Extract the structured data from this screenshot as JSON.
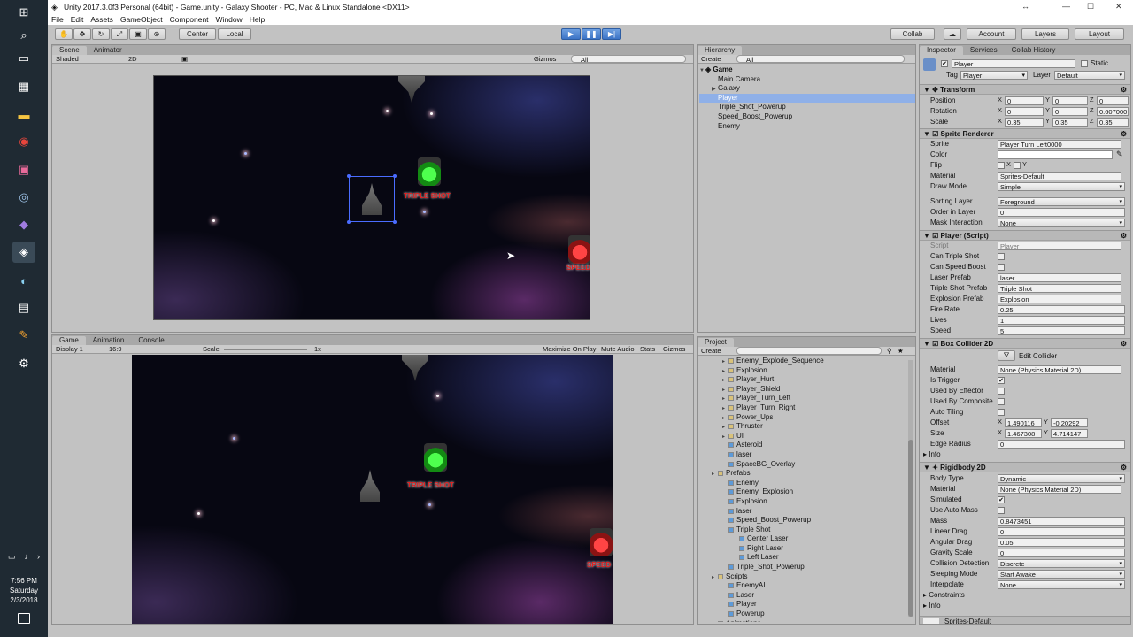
{
  "window": {
    "title": "Unity 2017.3.0f3 Personal (64bit) - Game.unity - Galaxy Shooter - PC, Mac & Linux Standalone <DX11>"
  },
  "menu": [
    "File",
    "Edit",
    "Assets",
    "GameObject",
    "Component",
    "Window",
    "Help"
  ],
  "toolbar": {
    "center": "Center",
    "local": "Local",
    "collab": "Collab",
    "account": "Account",
    "layers": "Layers",
    "layout": "Layout"
  },
  "taskbar": {
    "time": "7:56 PM",
    "day": "Saturday",
    "date": "2/3/2018"
  },
  "scene": {
    "tabs": [
      "Scene",
      "Animator"
    ],
    "shading": "Shaded",
    "mode2d": "2D",
    "gizmos": "Gizmos",
    "search": "All",
    "triple_shot_label": "TRIPLE SHOT",
    "speed_label": "SPEED"
  },
  "game": {
    "tabs": [
      "Game",
      "Animation",
      "Console"
    ],
    "display": "Display 1",
    "aspect": "16:9",
    "scale_label": "Scale",
    "scale_value": "1x",
    "maximize": "Maximize On Play",
    "mute": "Mute Audio",
    "stats": "Stats",
    "gizmos": "Gizmos",
    "triple_shot_label": "TRIPLE SHOT",
    "speed_label": "SPEED"
  },
  "hierarchy": {
    "title": "Hierarchy",
    "create": "Create",
    "search": "All",
    "root": "Game",
    "items": [
      {
        "label": "Main Camera",
        "indent": 1,
        "selected": false,
        "expandable": false
      },
      {
        "label": "Galaxy",
        "indent": 1,
        "selected": false,
        "expandable": true
      },
      {
        "label": "Player",
        "indent": 1,
        "selected": true,
        "expandable": false
      },
      {
        "label": "Triple_Shot_Powerup",
        "indent": 1,
        "selected": false,
        "expandable": false
      },
      {
        "label": "Speed_Boost_Powerup",
        "indent": 1,
        "selected": false,
        "expandable": false
      },
      {
        "label": "Enemy",
        "indent": 1,
        "selected": false,
        "expandable": false
      }
    ]
  },
  "project": {
    "title": "Project",
    "create": "Create",
    "items": [
      {
        "label": "Enemy_Explode_Sequence",
        "indent": 2,
        "folder": true
      },
      {
        "label": "Explosion",
        "indent": 2,
        "folder": true
      },
      {
        "label": "Player_Hurt",
        "indent": 2,
        "folder": true
      },
      {
        "label": "Player_Shield",
        "indent": 2,
        "folder": true
      },
      {
        "label": "Player_Turn_Left",
        "indent": 2,
        "folder": true
      },
      {
        "label": "Player_Turn_Right",
        "indent": 2,
        "folder": true
      },
      {
        "label": "Power_Ups",
        "indent": 2,
        "folder": true
      },
      {
        "label": "Thruster",
        "indent": 2,
        "folder": true
      },
      {
        "label": "UI",
        "indent": 2,
        "folder": true
      },
      {
        "label": "Asteroid",
        "indent": 2,
        "folder": false
      },
      {
        "label": "laser",
        "indent": 2,
        "folder": false
      },
      {
        "label": "SpaceBG_Overlay",
        "indent": 2,
        "folder": false
      },
      {
        "label": "Prefabs",
        "indent": 1,
        "folder": true
      },
      {
        "label": "Enemy",
        "indent": 2,
        "folder": false
      },
      {
        "label": "Enemy_Explosion",
        "indent": 2,
        "folder": false
      },
      {
        "label": "Explosion",
        "indent": 2,
        "folder": false
      },
      {
        "label": "laser",
        "indent": 2,
        "folder": false
      },
      {
        "label": "Speed_Boost_Powerup",
        "indent": 2,
        "folder": false
      },
      {
        "label": "Triple Shot",
        "indent": 2,
        "folder": false
      },
      {
        "label": "Center Laser",
        "indent": 3,
        "folder": false
      },
      {
        "label": "Right Laser",
        "indent": 3,
        "folder": false
      },
      {
        "label": "Left Laser",
        "indent": 3,
        "folder": false
      },
      {
        "label": "Triple_Shot_Powerup",
        "indent": 2,
        "folder": false
      },
      {
        "label": "Scripts",
        "indent": 1,
        "folder": true
      },
      {
        "label": "EnemyAI",
        "indent": 2,
        "folder": false
      },
      {
        "label": "Laser",
        "indent": 2,
        "folder": false
      },
      {
        "label": "Player",
        "indent": 2,
        "folder": false
      },
      {
        "label": "Powerup",
        "indent": 2,
        "folder": false
      },
      {
        "label": "Animations",
        "indent": 1,
        "folder": true
      }
    ]
  },
  "inspector": {
    "tabs": [
      "Inspector",
      "Services",
      "Collab History"
    ],
    "name": "Player",
    "static": "Static",
    "tag_label": "Tag",
    "tag": "Player",
    "layer_label": "Layer",
    "layer": "Default",
    "transform": {
      "title": "Transform",
      "position": {
        "label": "Position",
        "x": "0",
        "y": "0",
        "z": "0"
      },
      "rotation": {
        "label": "Rotation",
        "x": "0",
        "y": "0",
        "z": "0.607000"
      },
      "scale": {
        "label": "Scale",
        "x": "0.35",
        "y": "0.35",
        "z": "0.35"
      }
    },
    "sprite_renderer": {
      "title": "Sprite Renderer",
      "sprite_label": "Sprite",
      "sprite": "Player Turn Left0000",
      "color_label": "Color",
      "flip_label": "Flip",
      "flip_x": "X",
      "flip_y": "Y",
      "material_label": "Material",
      "material": "Sprites-Default",
      "draw_mode_label": "Draw Mode",
      "draw_mode": "Simple",
      "sorting_layer_label": "Sorting Layer",
      "sorting_layer": "Foreground",
      "order_label": "Order in Layer",
      "order": "0",
      "mask_label": "Mask Interaction",
      "mask": "None"
    },
    "player_script": {
      "title": "Player (Script)",
      "script_label": "Script",
      "script": "Player",
      "triple_label": "Can Triple Shot",
      "speed_boost_label": "Can Speed Boost",
      "laser_label": "Laser Prefab",
      "laser": "laser",
      "triple_prefab_label": "Triple Shot Prefab",
      "triple_prefab": "Triple Shot",
      "explosion_label": "Explosion Prefab",
      "explosion": "Explosion",
      "fire_rate_label": "Fire Rate",
      "fire_rate": "0.25",
      "lives_label": "Lives",
      "lives": "1",
      "speed_label": "Speed",
      "speed": "5"
    },
    "box_collider": {
      "title": "Box Collider 2D",
      "edit": "Edit Collider",
      "material_label": "Material",
      "material": "None (Physics Material 2D)",
      "trigger_label": "Is Trigger",
      "effector_label": "Used By Effector",
      "composite_label": "Used By Composite",
      "tiling_label": "Auto Tiling",
      "offset_label": "Offset",
      "offset_x": "1.490116",
      "offset_y": "-0.20292",
      "size_label": "Size",
      "size_x": "1.467308",
      "size_y": "4.714147",
      "edge_label": "Edge Radius",
      "edge": "0",
      "info": "Info"
    },
    "rigidbody": {
      "title": "Rigidbody 2D",
      "body_type_label": "Body Type",
      "body_type": "Dynamic",
      "material_label": "Material",
      "material": "None (Physics Material 2D)",
      "simulated_label": "Simulated",
      "auto_mass_label": "Use Auto Mass",
      "mass_label": "Mass",
      "mass": "0.8473451",
      "linear_label": "Linear Drag",
      "linear": "0",
      "angular_label": "Angular Drag",
      "angular": "0.05",
      "gravity_label": "Gravity Scale",
      "gravity": "0",
      "collision_label": "Collision Detection",
      "collision": "Discrete",
      "sleep_label": "Sleeping Mode",
      "sleep": "Start Awake",
      "interp_label": "Interpolate",
      "interp": "None",
      "constraints": "Constraints",
      "info": "Info"
    },
    "footer_material": "Sprites-Default"
  }
}
